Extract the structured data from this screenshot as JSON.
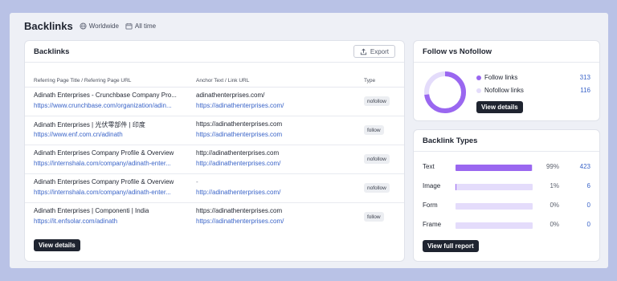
{
  "header": {
    "title": "Backlinks",
    "scope": "Worldwide",
    "period": "All time"
  },
  "backlinks_card": {
    "title": "Backlinks",
    "export_label": "Export",
    "col_ref": "Referring Page Title / Referring Page URL",
    "col_anchor": "Anchor Text / Link URL",
    "col_type": "Type",
    "rows": [
      {
        "ref_title": "Adinath Enterprises - Crunchbase Company Pro...",
        "ref_url": "https://www.crunchbase.com/organization/adin...",
        "anchor": "adinathenterprises.com/",
        "link_url": "https://adinathenterprises.com/",
        "type": "nofollow"
      },
      {
        "ref_title": "Adinath Enterprises | 光伏零部件 | 印度",
        "ref_url": "https://www.enf.com.cn/adinath",
        "anchor": "https://adinathenterprises.com",
        "link_url": "https://adinathenterprises.com",
        "type": "follow"
      },
      {
        "ref_title": "Adinath Enterprises Company Profile & Overview",
        "ref_url": "https://internshala.com/company/adinath-enter...",
        "anchor": "http://adinathenterprises.com",
        "link_url": "http://adinathenterprises.com/",
        "type": "nofollow"
      },
      {
        "ref_title": "Adinath Enterprises Company Profile & Overview",
        "ref_url": "https://internshala.com/company/adinath-enter...",
        "anchor": "-",
        "link_url": "http://adinathenterprises.com/",
        "type": "nofollow"
      },
      {
        "ref_title": "Adinath Enterprises | Componenti | India",
        "ref_url": "https://it.enfsolar.com/adinath",
        "anchor": "https://adinathenterprises.com",
        "link_url": "https://adinathenterprises.com/",
        "type": "follow"
      }
    ],
    "view_details": "View details"
  },
  "follow_card": {
    "title": "Follow vs Nofollow",
    "follow_label": "Follow links",
    "follow_value": "313",
    "nofollow_label": "Nofollow links",
    "nofollow_value": "116",
    "view_details": "View details",
    "colors": {
      "follow": "#9a67f0",
      "nofollow": "#e4dcfb"
    }
  },
  "types_card": {
    "title": "Backlink Types",
    "rows": [
      {
        "name": "Text",
        "pct": "99%",
        "count": "423",
        "fraction": 0.99
      },
      {
        "name": "Image",
        "pct": "1%",
        "count": "6",
        "fraction": 0.014
      },
      {
        "name": "Form",
        "pct": "0%",
        "count": "0",
        "fraction": 0
      },
      {
        "name": "Frame",
        "pct": "0%",
        "count": "0",
        "fraction": 0
      }
    ],
    "view_report": "View full report"
  }
}
